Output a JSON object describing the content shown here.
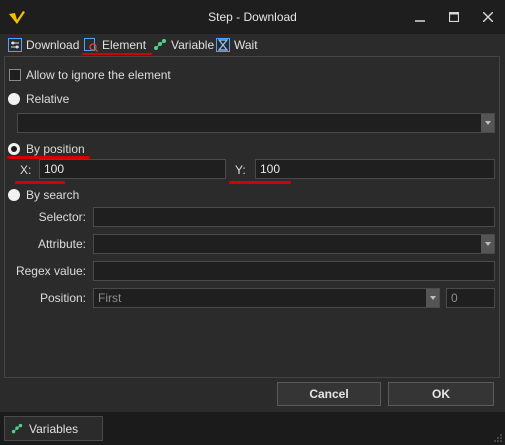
{
  "window": {
    "title": "Step - Download",
    "minimize_icon": "minimize-icon",
    "maximize_icon": "maximize-icon",
    "close_icon": "close-icon"
  },
  "tabs": [
    {
      "label": "Download",
      "icon": "sliders-icon",
      "active": false
    },
    {
      "label": "Element",
      "icon": "element-target-icon",
      "active": true
    },
    {
      "label": "Variable",
      "icon": "variable-icon",
      "active": false
    },
    {
      "label": "Wait",
      "icon": "hourglass-icon",
      "active": false
    }
  ],
  "element": {
    "allow_ignore_label": "Allow to ignore the element",
    "allow_ignore_checked": false,
    "relative_label": "Relative",
    "relative_value": "",
    "by_position_label": "By position",
    "x_label": "X:",
    "x_value": "100",
    "y_label": "Y:",
    "y_value": "100",
    "by_search_label": "By search",
    "selector_label": "Selector:",
    "selector_value": "",
    "attribute_label": "Attribute:",
    "attribute_value": "",
    "regex_label": "Regex value:",
    "regex_value": "",
    "position_label": "Position:",
    "position_value": "First",
    "position_index": "0",
    "selected_mode": "By position"
  },
  "buttons": {
    "cancel": "Cancel",
    "ok": "OK"
  },
  "bottom": {
    "variables_tab": "Variables"
  },
  "colors": {
    "background": "#2b2b2b",
    "titlebar": "#1e1e1e",
    "field": "#1f1f1f",
    "highlight_red": "#d20000",
    "logo_yellow": "#f5c000"
  }
}
